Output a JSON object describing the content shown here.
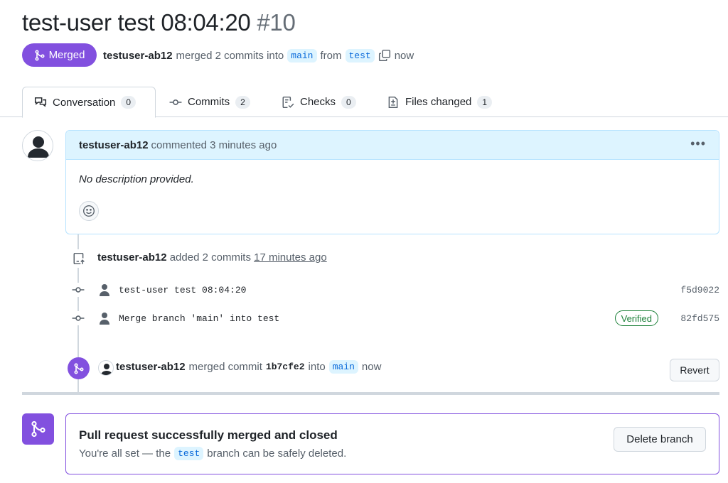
{
  "header": {
    "title": "test-user test 08:04:20",
    "number": "#10",
    "state_label": "Merged",
    "author": "testuser-ab12",
    "merged_text": "merged 2 commits into",
    "base_branch": "main",
    "from_text": "from",
    "head_branch": "test",
    "time": "now"
  },
  "tabs": [
    {
      "label": "Conversation",
      "count": "0"
    },
    {
      "label": "Commits",
      "count": "2"
    },
    {
      "label": "Checks",
      "count": "0"
    },
    {
      "label": "Files changed",
      "count": "1"
    }
  ],
  "comment": {
    "author": "testuser-ab12",
    "action": "commented 3 minutes ago",
    "body": "No description provided."
  },
  "push_event": {
    "author": "testuser-ab12",
    "action": "added 2 commits",
    "time": "17 minutes ago"
  },
  "commits": [
    {
      "message": "test-user test 08:04:20",
      "sha": "f5d9022",
      "verified": ""
    },
    {
      "message": "Merge branch 'main' into test",
      "sha": "82fd575",
      "verified": "Verified"
    }
  ],
  "merge_event": {
    "author": "testuser-ab12",
    "action": "merged commit",
    "sha": "1b7cfe2",
    "into_text": "into",
    "branch": "main",
    "time": "now",
    "revert_label": "Revert"
  },
  "merge_box": {
    "title": "Pull request successfully merged and closed",
    "desc_prefix": "You're all set — the",
    "branch": "test",
    "desc_suffix": "branch can be safely deleted.",
    "delete_label": "Delete branch"
  },
  "colors": {
    "merged_purple": "#8250df",
    "comment_header_bg": "#ddf4ff",
    "verified_green": "#1a7f37"
  }
}
